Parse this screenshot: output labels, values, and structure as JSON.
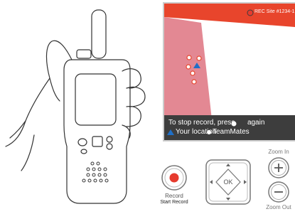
{
  "screen": {
    "rec_label": "REC Site #1234-1",
    "stop_instruction_before": "To stop record, press",
    "stop_instruction_after": "again",
    "legend_your_location": "Your location",
    "legend_teammates": "TeamMates"
  },
  "controls": {
    "record_label": "Record",
    "start_record_label": "Start Record",
    "ok_label": "OK",
    "zoom_in_label": "Zoom In",
    "zoom_out_label": "Zoom Out"
  },
  "colors": {
    "map_red": "#e8452c",
    "zone_pink": "#e38893",
    "screen_dark": "#3d3d3d",
    "your_location_blue": "#1f6fc7",
    "record_red": "#e63b2e"
  },
  "icons": {
    "radio": "handheld-radio-icon",
    "record": "record-icon",
    "dpad": "dpad-icon",
    "zoom_in": "plus-icon",
    "zoom_out": "minus-icon"
  }
}
